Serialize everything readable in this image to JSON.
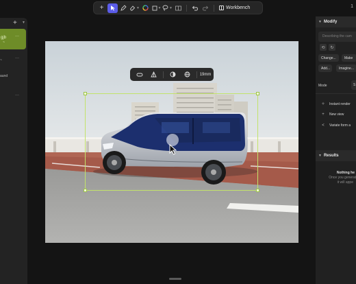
{
  "toolbar": {
    "add_icon": "plus-icon",
    "select_icon": "cursor-arrow-icon",
    "pen_icon": "pen-icon",
    "eraser_icon": "eraser-icon",
    "color_icon": "color-wheel-icon",
    "shape_icon": "square-icon",
    "lasso_icon": "lasso-icon",
    "layout_icon": "columns-icon",
    "undo_icon": "undo-icon",
    "redo_icon": "redo-icon",
    "workbench_label": "Workbench",
    "accent": "#5b5ce8"
  },
  "top_right": {
    "label": "1"
  },
  "left_panel": {
    "add_label": "+",
    "selected_item": {
      "line1": "gjb",
      "line2": "~"
    },
    "item2": "~",
    "item3": "aund",
    "accent": "#6e8c28"
  },
  "image_toolbar": {
    "btn1_icon": "link-icon",
    "btn2_icon": "triangle-ruler-icon",
    "btn3_icon": "half-circle-icon",
    "btn4_icon": "globe-icon",
    "focal_length": "19mm"
  },
  "right_panel": {
    "modify_title": "Modify",
    "description_placeholder": "Describing the cam",
    "change_button": "Change...",
    "make_button": "Make",
    "add_button": "Add...",
    "imagine_button": "Imagine...",
    "mode_label": "Mode",
    "mode_value": "S",
    "actions": [
      {
        "icon": "sparkle-icon",
        "label": "Instant render"
      },
      {
        "icon": "plus-icon",
        "label": "New view"
      },
      {
        "icon": "share-icon",
        "label": "Variate form a"
      }
    ],
    "results_title": "Results",
    "nothing_text": "Nothing he",
    "once_text": "Once you generat",
    "appear_text": "it will appe"
  },
  "selection_color": "#c2e36a"
}
